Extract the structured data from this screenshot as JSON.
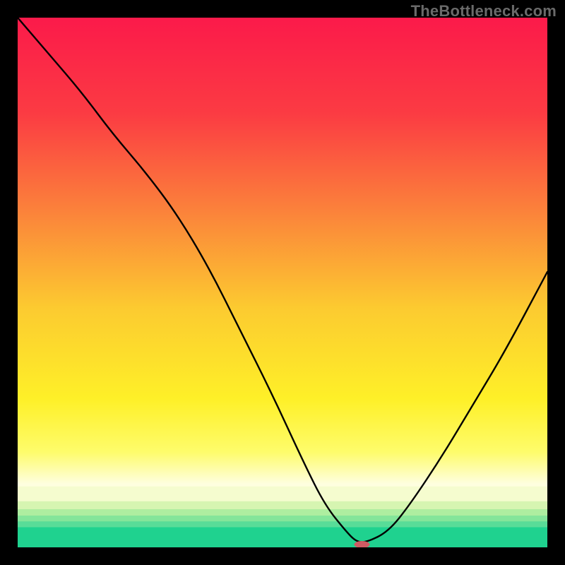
{
  "watermark": "TheBottleneck.com",
  "chart_data": {
    "type": "line",
    "title": "",
    "xlabel": "",
    "ylabel": "",
    "xlim": [
      0,
      100
    ],
    "ylim": [
      0,
      100
    ],
    "grid": false,
    "series": [
      {
        "name": "curve",
        "color": "#000000",
        "x": [
          0,
          6,
          12,
          18,
          24,
          30,
          36,
          42,
          48,
          54,
          58,
          62,
          64,
          66,
          70,
          74,
          80,
          86,
          92,
          100
        ],
        "y": [
          100,
          93,
          86,
          78,
          71,
          63,
          53,
          41,
          29,
          16,
          8,
          3,
          1,
          1,
          3,
          8,
          17,
          27,
          37,
          52
        ]
      }
    ],
    "marker": {
      "x": 65,
      "y": 0,
      "color": "#cf5b63",
      "rx": 11,
      "ry": 5
    },
    "background": {
      "type": "gradient-with-bands",
      "stops": [
        {
          "offset": 0.0,
          "color": "#fb1a4a"
        },
        {
          "offset": 0.18,
          "color": "#fb3b43"
        },
        {
          "offset": 0.36,
          "color": "#fb803b"
        },
        {
          "offset": 0.55,
          "color": "#fccb30"
        },
        {
          "offset": 0.72,
          "color": "#fef028"
        },
        {
          "offset": 0.82,
          "color": "#fefc6b"
        },
        {
          "offset": 0.88,
          "color": "#fefedf"
        }
      ],
      "bands": [
        {
          "y": 0.885,
          "h": 0.028,
          "color": "#f5fccf"
        },
        {
          "y": 0.913,
          "h": 0.015,
          "color": "#d6f5b1"
        },
        {
          "y": 0.928,
          "h": 0.012,
          "color": "#aeeea0"
        },
        {
          "y": 0.94,
          "h": 0.011,
          "color": "#84e59a"
        },
        {
          "y": 0.951,
          "h": 0.011,
          "color": "#58dc98"
        },
        {
          "y": 0.962,
          "h": 0.038,
          "color": "#1fd28f"
        }
      ]
    }
  }
}
